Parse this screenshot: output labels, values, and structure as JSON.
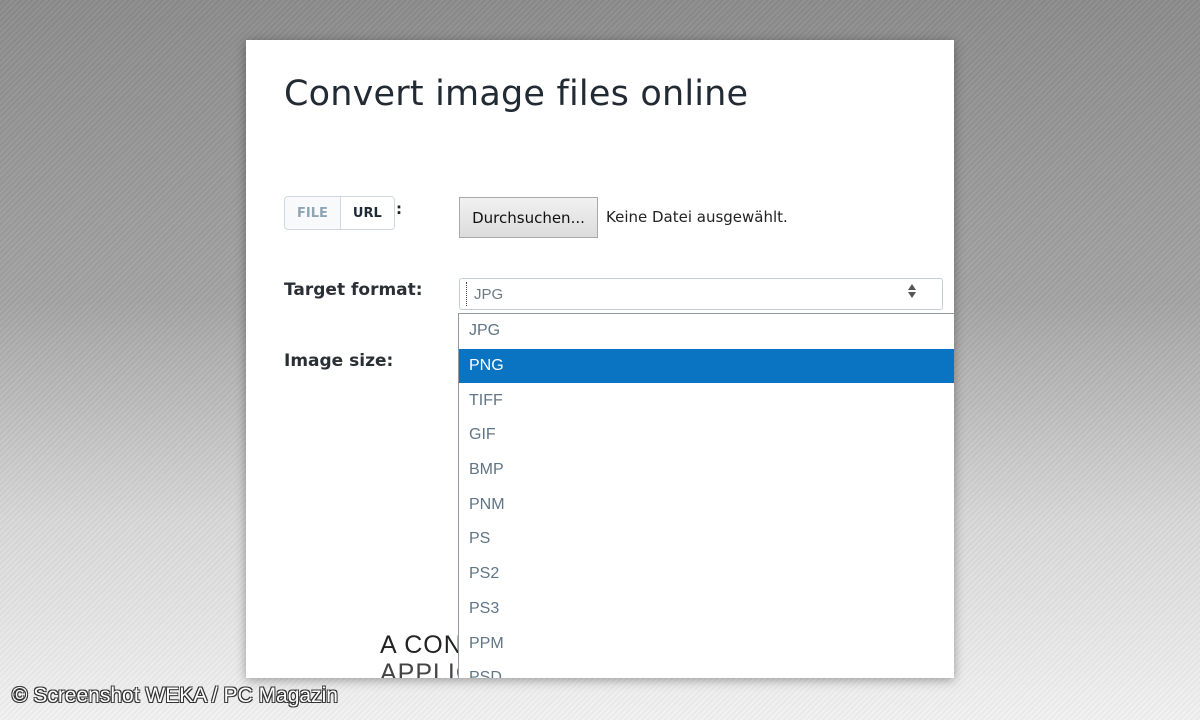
{
  "page": {
    "title": "Convert image files online"
  },
  "source_toggle": {
    "file_label": "FILE",
    "url_label": "URL",
    "colon": ":"
  },
  "file_input": {
    "button_label": "Durchsuchen...",
    "status": "Keine Datei ausgewählt."
  },
  "target_format": {
    "label": "Target format:",
    "selected_value": "JPG",
    "highlighted_option": "PNG",
    "options": [
      "JPG",
      "PNG",
      "TIFF",
      "GIF",
      "BMP",
      "PNM",
      "PS",
      "PS2",
      "PS3",
      "PPM",
      "PSD"
    ]
  },
  "image_size": {
    "label": "Image size:"
  },
  "background_text": {
    "line1": "A CON",
    "line2": "APPLIC"
  },
  "watermark": {
    "text": "© Screenshot WEKA / PC Magazin"
  },
  "colors": {
    "highlight": "#0a74c2",
    "option_text": "#607585"
  },
  "icons": {
    "select_arrows": "sort-arrows-icon"
  }
}
